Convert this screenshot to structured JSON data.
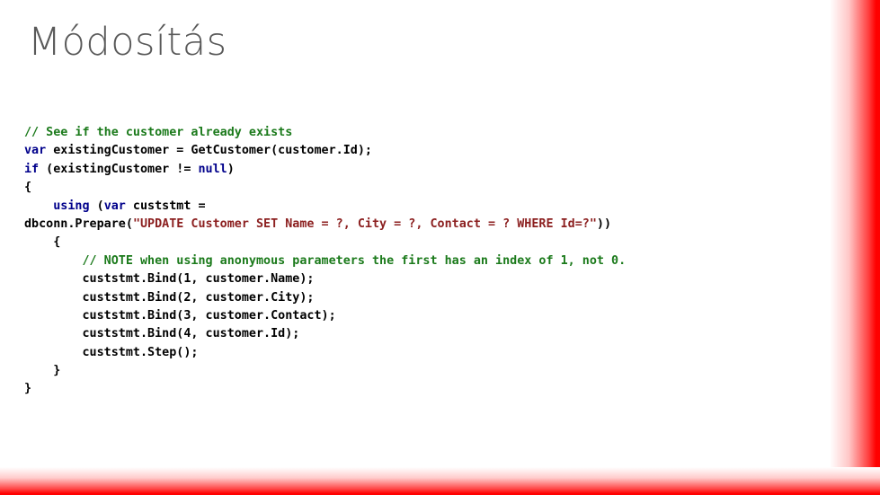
{
  "slide": {
    "title": "Módosítás",
    "background_color": "#FFFFFF",
    "title_color": "#595959",
    "accent_color": "#FF0000"
  },
  "decoration": {
    "right_band_name": "red-gradient-band-right",
    "bottom_band_name": "red-gradient-band-bottom"
  },
  "code": {
    "language": "csharp",
    "colors": {
      "comment": "#1B7A1B",
      "keyword": "#00008B",
      "identifier": "#000000",
      "string": "#8C2020"
    },
    "lines": [
      {
        "indent": 0,
        "tokens": [
          {
            "t": "cm",
            "v": "// See if the customer already exists"
          }
        ]
      },
      {
        "indent": 0,
        "tokens": [
          {
            "t": "kw",
            "v": "var"
          },
          {
            "t": "id",
            "v": " existingCustomer = GetCustomer(customer.Id);"
          }
        ]
      },
      {
        "indent": 0,
        "tokens": [
          {
            "t": "kw",
            "v": "if"
          },
          {
            "t": "id",
            "v": " (existingCustomer != "
          },
          {
            "t": "kw",
            "v": "null"
          },
          {
            "t": "id",
            "v": ")"
          }
        ]
      },
      {
        "indent": 0,
        "tokens": [
          {
            "t": "id",
            "v": "{"
          }
        ]
      },
      {
        "indent": 1,
        "tokens": [
          {
            "t": "kw",
            "v": "using"
          },
          {
            "t": "id",
            "v": " ("
          },
          {
            "t": "kw",
            "v": "var"
          },
          {
            "t": "id",
            "v": " custstmt ="
          }
        ]
      },
      {
        "indent": 0,
        "tokens": [
          {
            "t": "id",
            "v": "dbconn.Prepare("
          },
          {
            "t": "str",
            "v": "\"UPDATE Customer SET Name = ?, City = ?, Contact = ? WHERE Id=?\""
          },
          {
            "t": "id",
            "v": "))"
          }
        ]
      },
      {
        "indent": 1,
        "tokens": [
          {
            "t": "id",
            "v": "{"
          }
        ]
      },
      {
        "indent": 2,
        "tokens": [
          {
            "t": "cm",
            "v": "// NOTE when using anonymous parameters the first has an index of 1, not 0."
          }
        ]
      },
      {
        "indent": 2,
        "tokens": [
          {
            "t": "id",
            "v": "custstmt.Bind(1, customer.Name);"
          }
        ]
      },
      {
        "indent": 2,
        "tokens": [
          {
            "t": "id",
            "v": "custstmt.Bind(2, customer.City);"
          }
        ]
      },
      {
        "indent": 2,
        "tokens": [
          {
            "t": "id",
            "v": "custstmt.Bind(3, customer.Contact);"
          }
        ]
      },
      {
        "indent": 2,
        "tokens": [
          {
            "t": "id",
            "v": "custstmt.Bind(4, customer.Id);"
          }
        ]
      },
      {
        "indent": 2,
        "tokens": [
          {
            "t": "id",
            "v": "custstmt.Step();"
          }
        ]
      },
      {
        "indent": 1,
        "tokens": [
          {
            "t": "id",
            "v": "}"
          }
        ]
      },
      {
        "indent": 0,
        "tokens": [
          {
            "t": "id",
            "v": "}"
          }
        ]
      }
    ]
  }
}
